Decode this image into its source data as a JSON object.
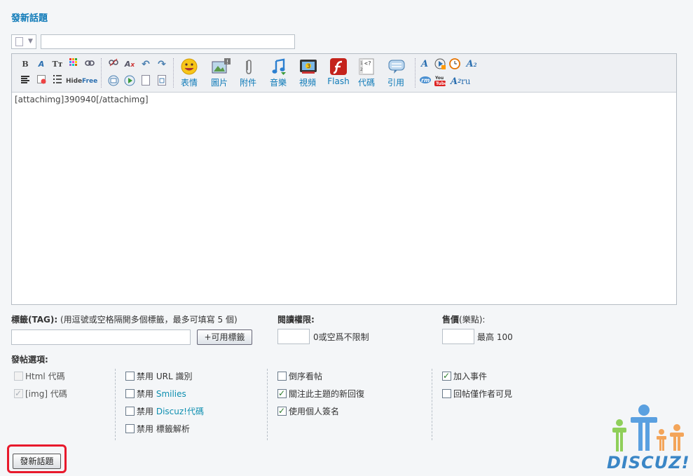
{
  "page": {
    "title": "發新話題"
  },
  "editor": {
    "content": "[attachimg]390940[/attachimg]",
    "toolbar": {
      "small_tools": [
        "B",
        "A",
        "Tт",
        "Hide",
        "Free"
      ],
      "big_buttons": [
        "表情",
        "圖片",
        "附件",
        "音樂",
        "視頻",
        "Flash",
        "代碼",
        "引用"
      ],
      "right_text": "ru"
    }
  },
  "tags": {
    "label": "標籤(TAG):",
    "hint": "(用逗號或空格隔開多個標籤，最多可填寫 5 個)",
    "button": "+可用標籤",
    "value": ""
  },
  "read_perm": {
    "label": "閱讀權限:",
    "hint": "0或空爲不限制",
    "value": ""
  },
  "price": {
    "label": "售價",
    "unit": "(樂點):",
    "hint": "最高 100",
    "value": ""
  },
  "options": {
    "label": "發帖選項:",
    "col1": [
      {
        "text": "Html 代碼",
        "checked": false,
        "disabled": true
      },
      {
        "text": "[img] 代碼",
        "checked": true,
        "disabled": true
      }
    ],
    "col2": [
      {
        "prefix": "禁用 ",
        "text": "URL 識別",
        "checked": false
      },
      {
        "prefix": "禁用 ",
        "text": "Smilies",
        "checked": false
      },
      {
        "prefix": "禁用 ",
        "text": "Discuz!代碼",
        "checked": false
      },
      {
        "prefix": "禁用 ",
        "text": "標籤解析",
        "checked": false
      }
    ],
    "col3": [
      {
        "text": "倒序看帖",
        "checked": false
      },
      {
        "text": "關注此主題的新回復",
        "checked": true
      },
      {
        "text": "使用個人簽名",
        "checked": true
      }
    ],
    "col4": [
      {
        "text": "加入事件",
        "checked": true
      },
      {
        "text": "回帖僅作者可見",
        "checked": false
      }
    ]
  },
  "submit": {
    "label": "發新話題"
  },
  "logo": {
    "text": "DISCUZ!"
  },
  "colors": {
    "accent": "#0e7ab8",
    "highlight": "#e8192c",
    "link": "#0e8fb0"
  }
}
